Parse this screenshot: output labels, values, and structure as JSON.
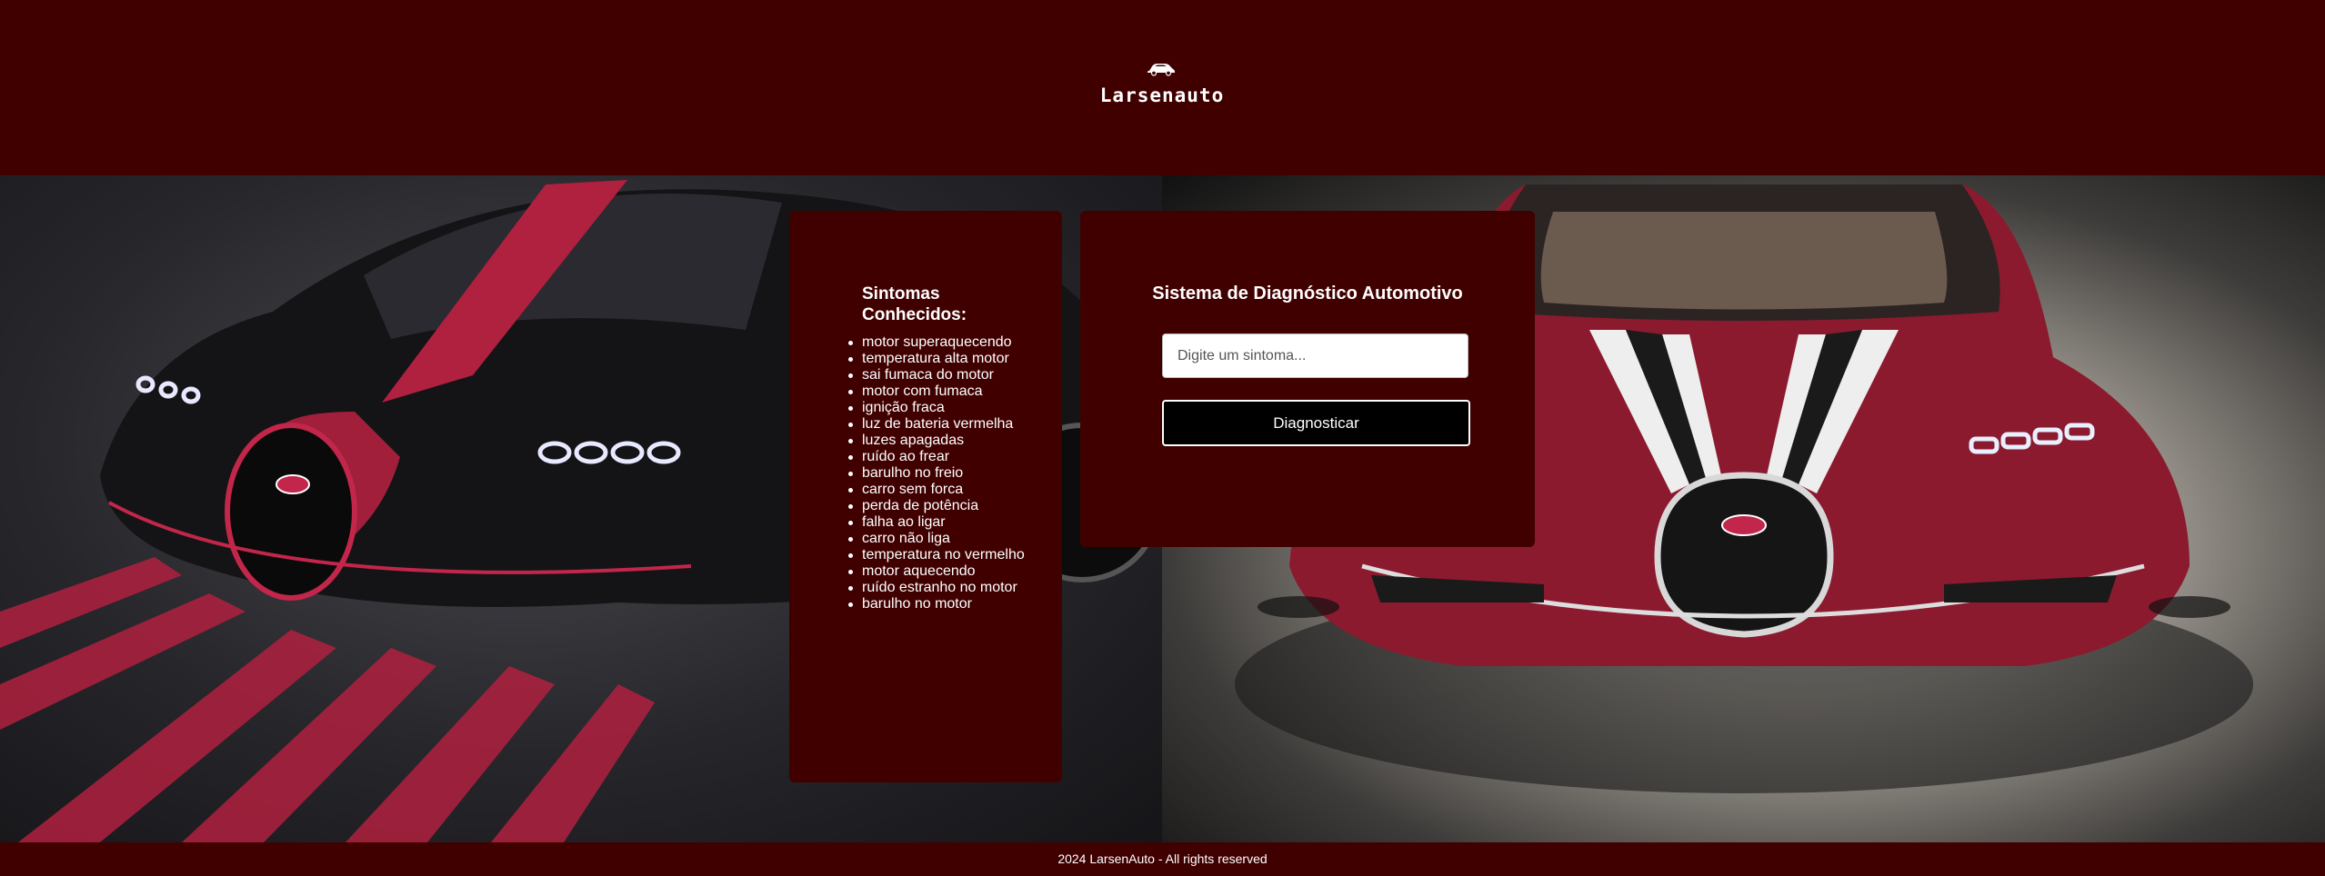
{
  "brand": {
    "logo_icon": "car-icon",
    "name": "Larsenauto"
  },
  "symptoms": {
    "heading": "Sintomas Conhecidos:",
    "items": [
      "motor superaquecendo",
      "temperatura alta motor",
      "sai fumaca do motor",
      "motor com fumaca",
      "ignição fraca",
      "luz de bateria vermelha",
      "luzes apagadas",
      "ruído ao frear",
      "barulho no freio",
      "carro sem forca",
      "perda de potência",
      "falha ao ligar",
      "carro não liga",
      "temperatura no vermelho",
      "motor aquecendo",
      "ruído estranho no motor",
      "barulho no motor"
    ]
  },
  "diagnosis": {
    "title": "Sistema de Diagnóstico Automotivo",
    "input_placeholder": "Digite um sintoma...",
    "input_value": "",
    "button_label": "Diagnosticar"
  },
  "footer": {
    "text": "2024 LarsenAuto - All rights reserved"
  },
  "colors": {
    "background": "#400000",
    "button": "#000000",
    "accent_red": "#9b1b38"
  }
}
